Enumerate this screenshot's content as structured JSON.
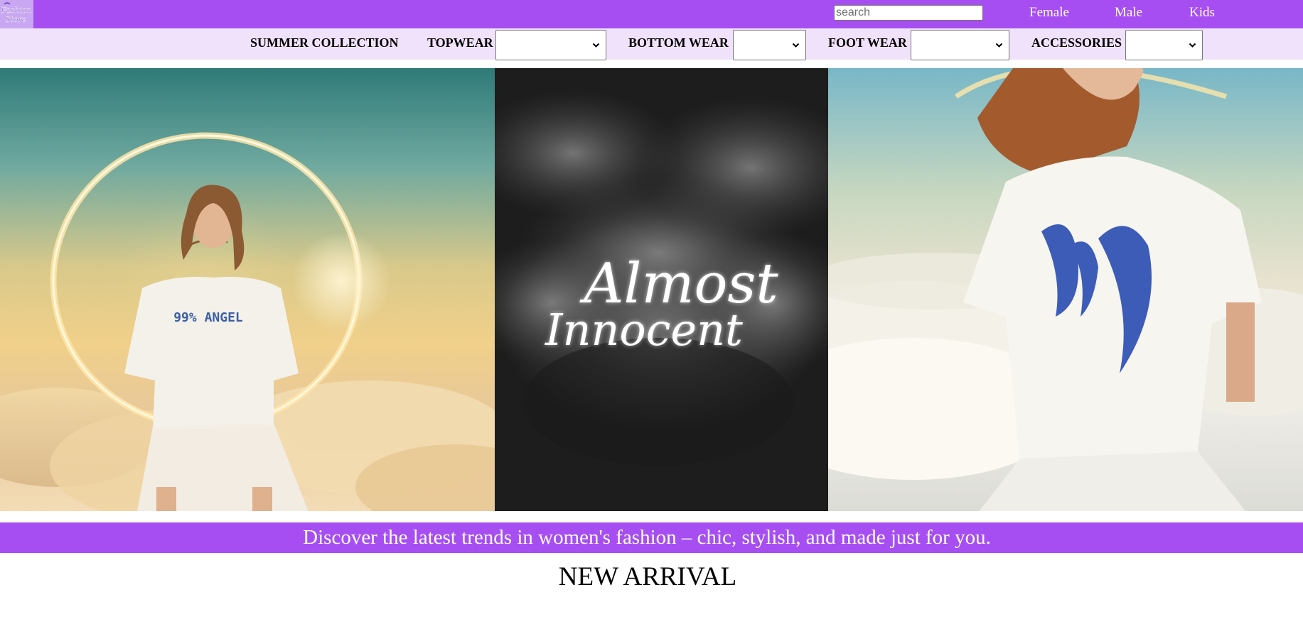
{
  "brand": {
    "logo_text_line1": "Fashion",
    "logo_text_line2": "Store",
    "icon": "store-logo"
  },
  "search": {
    "placeholder": "search",
    "value": ""
  },
  "nav": {
    "links": [
      {
        "label": "Female"
      },
      {
        "label": "Male"
      },
      {
        "label": "Kids"
      }
    ]
  },
  "categories": {
    "summer": "SUMMER COLLECTION",
    "topwear": "TOPWEAR",
    "bottomwear": "BOTTOM WEAR",
    "footwear": "FOOT WEAR",
    "accessories": "ACCESSORIES",
    "selected_values": {
      "topwear": "",
      "bottomwear": "",
      "footwear": "",
      "accessories": ""
    }
  },
  "hero": {
    "center_script_line1": "Almost",
    "center_script_line2": "Innocent",
    "left_shirt_text": "99% ANGEL"
  },
  "tagline": "Discover the latest trends in women's fashion – chic, stylish, and made just for you.",
  "section_title": "NEW ARRIVAL",
  "colors": {
    "primary": "#a64ef2",
    "catbar": "#f0e2fa",
    "white": "#ffffff"
  }
}
